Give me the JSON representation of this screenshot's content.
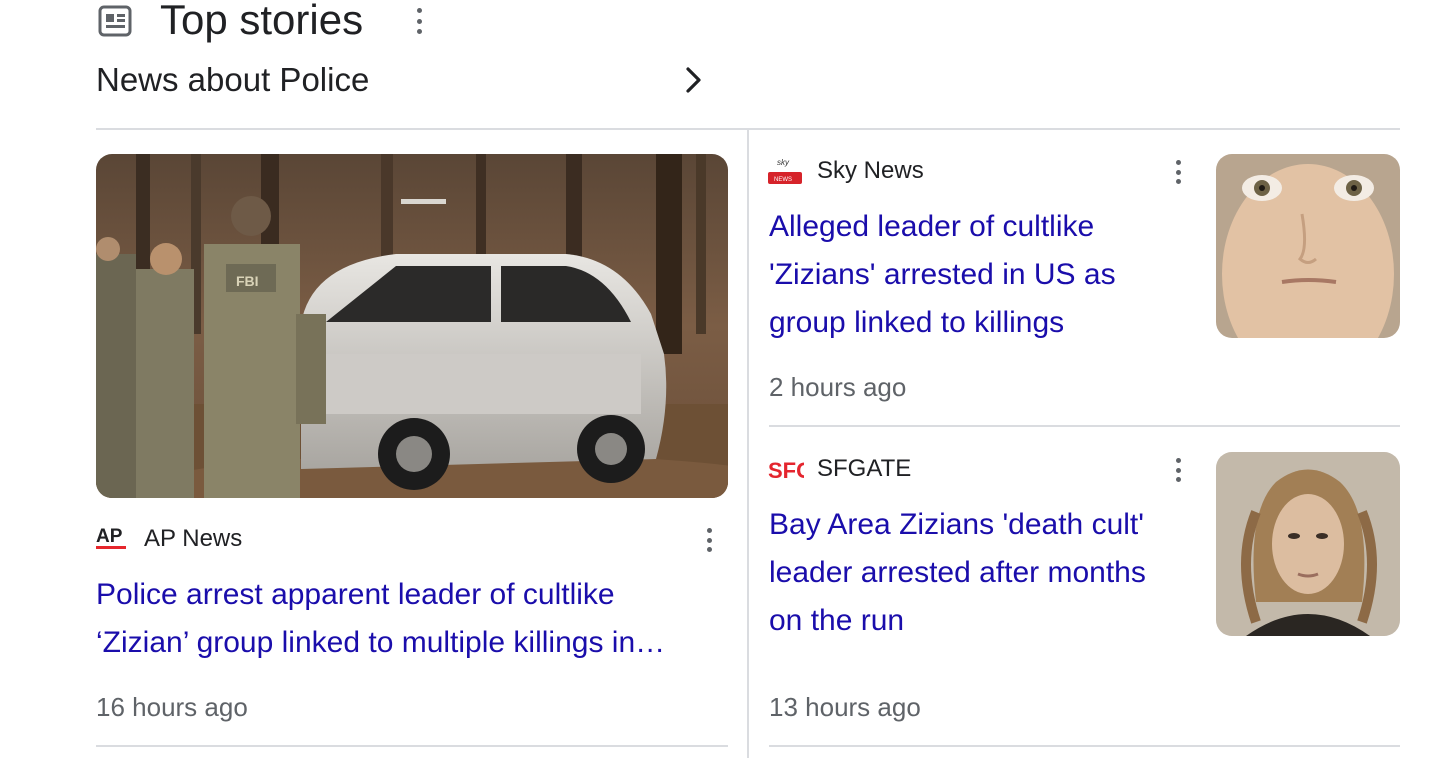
{
  "header": {
    "title": "Top stories",
    "subtitle": "News about Police",
    "icon": "newspaper-icon"
  },
  "stories": [
    {
      "source": "AP News",
      "logo_text": "AP",
      "headline_line1": "Police arrest apparent leader of cultlike",
      "headline_line2": "‘Zizian’ group linked to multiple killings in…",
      "time": "16 hours ago",
      "image": "fbi-agents-suv-photo"
    },
    {
      "source": "Sky News",
      "logo_text": "sky news",
      "headline_line1": "Alleged leader of cultlike",
      "headline_line2": "'Zizians' arrested in US as",
      "headline_line3": "group linked to killings",
      "time": "2 hours ago",
      "image": "mugshot-photo-1"
    },
    {
      "source": "SFGATE",
      "logo_text": "SFG",
      "headline_line1": "Bay Area Zizians 'death cult'",
      "headline_line2": "leader arrested after months",
      "headline_line3": "on the run",
      "time": "13 hours ago",
      "image": "mugshot-photo-2"
    }
  ],
  "colors": {
    "link": "#1a0dab",
    "muted": "#5f6368",
    "divider": "#dadce0",
    "ap_red": "#e6262c",
    "sky_red": "#d6232a",
    "sfg_red": "#e4252e"
  }
}
